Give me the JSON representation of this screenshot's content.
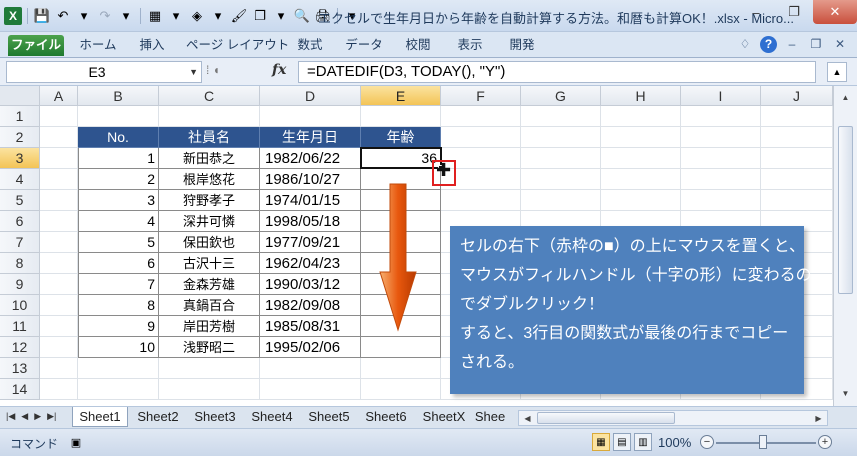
{
  "window": {
    "title": "エクセルで生年月日から年齢を自動計算する方法。和暦も計算OK！.xlsx - Micro...",
    "minimize": "–",
    "restore": "❐",
    "close": "✕"
  },
  "qat": {
    "app_icon": "X",
    "save_icon": "💾",
    "undo_icon": "↶",
    "redo_icon": "↷",
    "borders_icon": "▦",
    "fill_icon": "◈",
    "brush_icon": "🖌",
    "copy_icon": "❐",
    "preview_icon": "🔍",
    "print_icon": "🖨",
    "more_icon": "▾"
  },
  "ribbon": {
    "tabs": [
      "ファイル",
      "ホーム",
      "挿入",
      "ページ レイアウト",
      "数式",
      "データ",
      "校閲",
      "表示",
      "開発"
    ],
    "right_icons": {
      "caret": "♢",
      "help": "?",
      "min": "–",
      "restore": "❐",
      "close": "✕"
    }
  },
  "formula_bar": {
    "name_box": "E3",
    "fx": "fx",
    "formula": "=DATEDIF(D3, TODAY(), \"Y\")"
  },
  "grid": {
    "columns": [
      "A",
      "B",
      "C",
      "D",
      "E",
      "F",
      "G",
      "H",
      "I",
      "J"
    ],
    "rows": [
      "1",
      "2",
      "3",
      "4",
      "5",
      "6",
      "7",
      "8",
      "9",
      "10",
      "11",
      "12",
      "13",
      "14"
    ],
    "selected_column": "E",
    "selected_row": "3",
    "table_headers": [
      "No.",
      "社員名",
      "生年月日",
      "年齢"
    ],
    "table_rows": [
      {
        "no": "1",
        "name": "新田恭之",
        "dob": "1982/06/22",
        "age": "36"
      },
      {
        "no": "2",
        "name": "根岸悠花",
        "dob": "1986/10/27",
        "age": ""
      },
      {
        "no": "3",
        "name": "狩野孝子",
        "dob": "1974/01/15",
        "age": ""
      },
      {
        "no": "4",
        "name": "深井可憐",
        "dob": "1998/05/18",
        "age": ""
      },
      {
        "no": "5",
        "name": "保田欽也",
        "dob": "1977/09/21",
        "age": ""
      },
      {
        "no": "6",
        "name": "古沢十三",
        "dob": "1962/04/23",
        "age": ""
      },
      {
        "no": "7",
        "name": "金森芳雄",
        "dob": "1990/03/12",
        "age": ""
      },
      {
        "no": "8",
        "name": "真鍋百合",
        "dob": "1982/09/08",
        "age": ""
      },
      {
        "no": "9",
        "name": "岸田芳樹",
        "dob": "1985/08/31",
        "age": ""
      },
      {
        "no": "10",
        "name": "浅野昭二",
        "dob": "1995/02/06",
        "age": ""
      }
    ]
  },
  "callout": {
    "lines": [
      "セルの右下（赤枠の■）の上にマウスを置くと、",
      "マウスがフィルハンドル（十字の形）に変わるの",
      "でダブルクリック！",
      "すると、3行目の関数式が最後の行までコピー",
      "される。"
    ],
    "color": "#4f81bd"
  },
  "sheets": {
    "tabs": [
      "Sheet1",
      "Sheet2",
      "Sheet3",
      "Sheet4",
      "Sheet5",
      "Sheet6",
      "SheetX",
      "Shee"
    ],
    "active": "Sheet1"
  },
  "status": {
    "mode": "コマンド",
    "zoom": "100%"
  },
  "colors": {
    "header_fill": "#2e548f",
    "arrow": "#e8580e",
    "highlight": "#e02020"
  }
}
